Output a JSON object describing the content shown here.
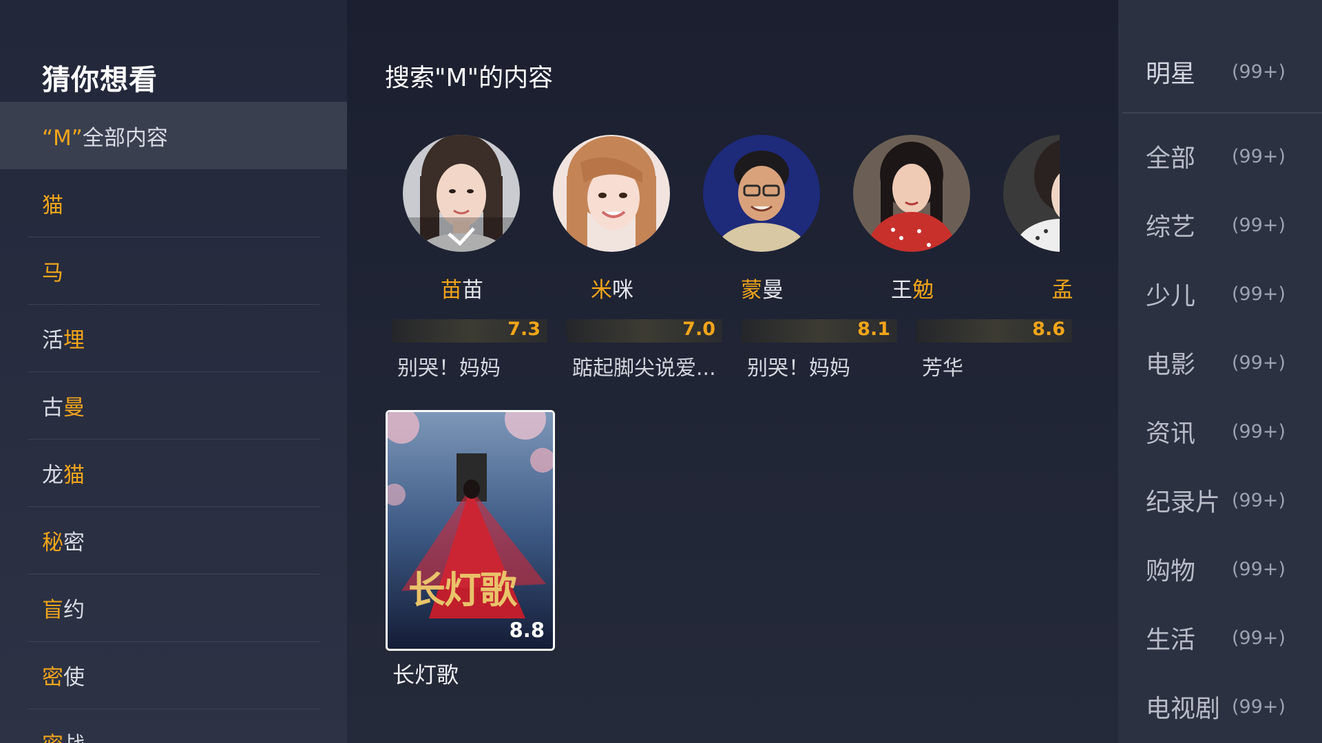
{
  "sidebar": {
    "title": "猜你想看",
    "items": [
      {
        "hl": "“M”",
        "rest": "全部内容",
        "order": "hl-first"
      },
      {
        "hl": "猫",
        "rest": "",
        "order": "hl-first"
      },
      {
        "hl": "马",
        "rest": "",
        "order": "hl-first"
      },
      {
        "pre": "活",
        "hl": "埋",
        "order": "pre-first"
      },
      {
        "pre": "古",
        "hl": "曼",
        "order": "pre-first"
      },
      {
        "pre": "龙",
        "hl": "猫",
        "order": "pre-first"
      },
      {
        "hl": "秘",
        "rest": "密",
        "order": "hl-first"
      },
      {
        "hl": "盲",
        "rest": "约",
        "order": "hl-first"
      },
      {
        "hl": "密",
        "rest": "使",
        "order": "hl-first"
      },
      {
        "hl": "密",
        "rest": "战",
        "order": "hl-first"
      }
    ]
  },
  "main": {
    "title": "搜索\"M\"的内容",
    "people": [
      {
        "hl": "苗",
        "rest": "苗",
        "order": "hl-first"
      },
      {
        "hl": "米",
        "rest": "咪",
        "order": "hl-first"
      },
      {
        "hl": "蒙",
        "rest": "曼",
        "order": "hl-first"
      },
      {
        "pre": "王",
        "hl": "勉",
        "order": "pre-first"
      },
      {
        "hl": "孟",
        "rest": "",
        "order": "hl-first"
      }
    ],
    "works": [
      {
        "score": "7.3",
        "title": "别哭！妈妈"
      },
      {
        "score": "7.0",
        "title": "踮起脚尖说爱..."
      },
      {
        "score": "8.1",
        "title": "别哭！妈妈"
      },
      {
        "score": "8.6",
        "title": "芳华"
      }
    ],
    "poster": {
      "score": "8.8",
      "title": "长灯歌",
      "logo_text": "长灯歌"
    }
  },
  "categories": [
    {
      "name": "明星",
      "count": "(99+)"
    },
    {
      "name": "全部",
      "count": "(99+)"
    },
    {
      "name": "综艺",
      "count": "(99+)"
    },
    {
      "name": "少儿",
      "count": "(99+)"
    },
    {
      "name": "电影",
      "count": "(99+)"
    },
    {
      "name": "资讯",
      "count": "(99+)"
    },
    {
      "name": "纪录片",
      "count": "(99+)"
    },
    {
      "name": "购物",
      "count": "(99+)"
    },
    {
      "name": "生活",
      "count": "(99+)"
    },
    {
      "name": "电视剧",
      "count": "(99+)"
    }
  ],
  "colors": {
    "highlight": "#f2a51a",
    "background": "#1e2233",
    "sidebar": "#2d3245",
    "right_panel": "#2c3142"
  }
}
